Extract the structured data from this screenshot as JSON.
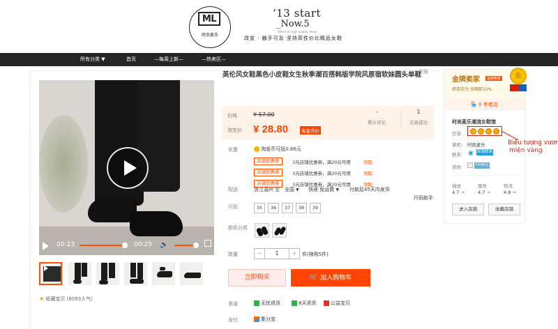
{
  "header": {
    "logo_text": "ML",
    "logo_sub": "时尚麦乐",
    "slogan_line1": "‘13 start",
    "slogan_line2": "_Now.5",
    "slogan_en": "Select an high quality shoes",
    "slogan_cn": "改变 · 触手可及  坚持高性价比精品女鞋"
  },
  "nav": {
    "items": [
      "所有分类",
      "首页",
      "—每周上新—",
      "—热卖区—"
    ]
  },
  "report_label": "举报",
  "video": {
    "current_time": "00:23",
    "duration": "00:25",
    "progress": 0.92,
    "volume": 0.9
  },
  "thumbnails_count": 6,
  "favorite": "收藏宝贝 (6093人气)",
  "product": {
    "title": "英伦风女鞋黑色小皮鞋女生秋季潮百搭韩版学院风原宿软妹圆头单鞋",
    "price_label": "价格",
    "original_price": "¥ 57.00",
    "taobao_price_label": "淘宝价",
    "current_price": "¥ 28.80",
    "price_tag": "淘金币价",
    "reviews_count": "-",
    "reviews_label": "累计评论",
    "sales_count": "1",
    "sales_label": "交易成功"
  },
  "promotions": {
    "label": "优惠",
    "coin_text": "淘金币可抵0.86元",
    "coupons": [
      {
        "tag": "店铺优惠券",
        "text": "3元店铺优惠券，满20元可用",
        "action": "领取"
      },
      {
        "tag": "店铺优惠券",
        "text": "3元店铺优惠券，满20元可用",
        "action": "领取"
      },
      {
        "tag": "店铺优惠券",
        "text": "3元店铺优惠券，满20元可用",
        "action": "领取"
      }
    ]
  },
  "delivery": {
    "label": "配送",
    "from": "浙江温州 至",
    "to": "全国",
    "shipping": "快递 免运费",
    "time": "付款后45天内发货"
  },
  "size": {
    "label": "尺码",
    "guide": "尺码助手",
    "options": [
      "35",
      "36",
      "37",
      "38",
      "39"
    ]
  },
  "color": {
    "label": "颜色分类"
  },
  "quantity": {
    "label": "数量",
    "minus": "−",
    "value": "1",
    "plus": "+",
    "unit": "件(限购5件)"
  },
  "buttons": {
    "buy_now": "立即购买",
    "add_to_cart": "加入购物车"
  },
  "guarantee": {
    "label": "承诺",
    "items": [
      "无忧退货",
      "8天退货",
      "公益宝贝"
    ]
  },
  "payment": {
    "label": "支付",
    "items": [
      "集分宝"
    ]
  },
  "seller": {
    "gold_title": "金牌卖家",
    "gold_tag": "金牌卖家",
    "gold_sub": "综合实力  全网前15%",
    "medal_text": "金",
    "years": "8 年老店",
    "shop_name": "时尚麦乐潮流女鞋馆",
    "credit_label": "信誉:",
    "keeper_label": "掌柜:",
    "keeper_value": "时尚麦乐",
    "contact_label": "联系:",
    "contact_value": "和我联系",
    "qualification_label": "资质:",
    "qualification_value": "7448元",
    "scores": [
      {
        "label": "描述",
        "value": "4.7"
      },
      {
        "label": "服务",
        "value": "4.7"
      },
      {
        "label": "物流",
        "value": "4.8"
      }
    ],
    "enter_shop": "进入店铺",
    "fav_shop": "收藏店铺"
  },
  "annotation": {
    "line1": "Biểu tượng vương",
    "line2": "miện vàng",
    "color": "#d81e06"
  },
  "colors": {
    "accent": "#ff4400",
    "nav_bg": "#262626"
  }
}
